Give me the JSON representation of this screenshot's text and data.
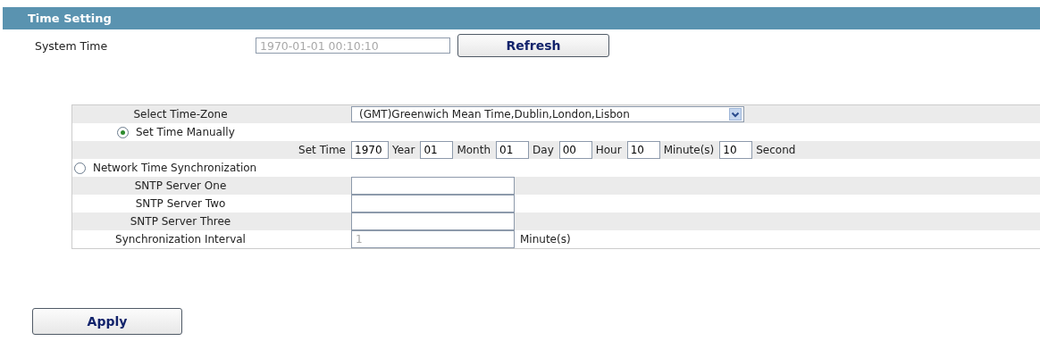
{
  "header": {
    "title": "Time Setting"
  },
  "system_time": {
    "label": "System Time",
    "value": "1970-01-01 00:10:10",
    "disabled": true,
    "button": "Refresh"
  },
  "time_zone": {
    "label": "Select Time-Zone",
    "value": "(GMT)Greenwich Mean Time,Dublin,London,Lisbon"
  },
  "modes": [
    {
      "label": "Set Time Manually",
      "selected": true
    },
    {
      "label": "Network Time Synchronization",
      "selected": false
    }
  ],
  "set_time": {
    "label": "Set Time",
    "fields": [
      {
        "value": "1970",
        "unit": "Year"
      },
      {
        "value": "01",
        "unit": "Month"
      },
      {
        "value": "01",
        "unit": "Day"
      },
      {
        "value": "00",
        "unit": "Hour"
      },
      {
        "value": "10",
        "unit": "Minute(s)"
      },
      {
        "value": "10",
        "unit": "Second"
      }
    ]
  },
  "sntp_servers": [
    {
      "label": "SNTP Server One"
    },
    {
      "label": "SNTP Server Two"
    },
    {
      "label": "SNTP Server Three"
    }
  ],
  "interval": {
    "label": "Synchronization Interval",
    "value": "1",
    "disabled": true,
    "unit": "Minute(s)"
  },
  "apply_button": "Apply"
}
